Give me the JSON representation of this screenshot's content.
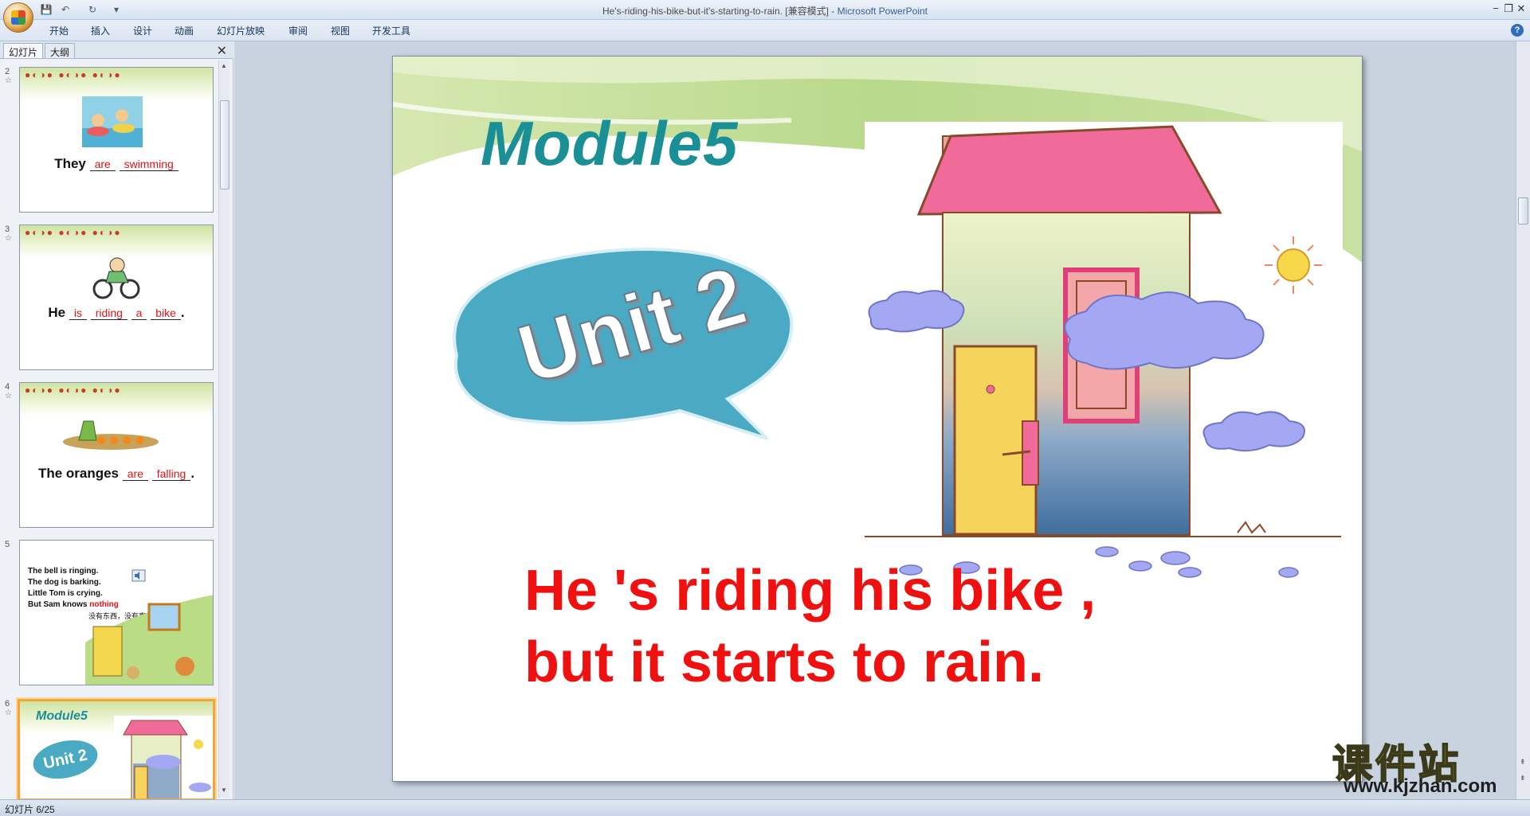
{
  "window": {
    "title": "He's-riding-his-bike-but-it's-starting-to-rain. [兼容模式]",
    "app_name": "Microsoft PowerPoint",
    "separator": "-",
    "minimize": "−",
    "restore": "❐",
    "close": "✕"
  },
  "quick_access": {
    "save_icon": "💾",
    "undo_icon": "↶",
    "redo_icon": "↻",
    "more_icon": "▾"
  },
  "ribbon": {
    "tabs": [
      "开始",
      "插入",
      "设计",
      "动画",
      "幻灯片放映",
      "审阅",
      "视图",
      "开发工具"
    ],
    "help": "?"
  },
  "panel": {
    "tabs": [
      "幻灯片",
      "大纲"
    ],
    "close": "✕"
  },
  "thumbnails": [
    {
      "num": "2",
      "subject": "They",
      "blank1": "are",
      "blank2": "swimming",
      "end": ""
    },
    {
      "num": "3",
      "subject": "He",
      "blank1": "is",
      "blank2": "riding",
      "blank3": "a",
      "blank4": "bike",
      "end": "."
    },
    {
      "num": "4",
      "subject": "The oranges",
      "blank1": "are",
      "blank2": "falling",
      "end": "."
    },
    {
      "num": "5",
      "lines": [
        "The bell is ringing.",
        "The dog is barking.",
        "Little Tom is crying.",
        "But Sam knows"
      ],
      "highlight": "nothing",
      "cn_note": "没有东西，没有事情"
    },
    {
      "num": "6",
      "title": "Module5",
      "unit": "Unit 2"
    }
  ],
  "slide": {
    "title": "Module5",
    "unit": "Unit 2",
    "line1": "He 's riding his bike ,",
    "line2": "but it starts to rain."
  },
  "status": {
    "slide_counter": "幻灯片 6/25"
  },
  "watermark": {
    "cn": "课件站",
    "url": "www.kjzhan.com"
  },
  "colors": {
    "title_teal": "#1a8f96",
    "bubble_blue": "#4aa9c3",
    "text_red": "#f01010",
    "roof_pink": "#f06a9a",
    "cloud_purple": "#a4a8f2",
    "sun_yellow": "#f6d84a"
  }
}
